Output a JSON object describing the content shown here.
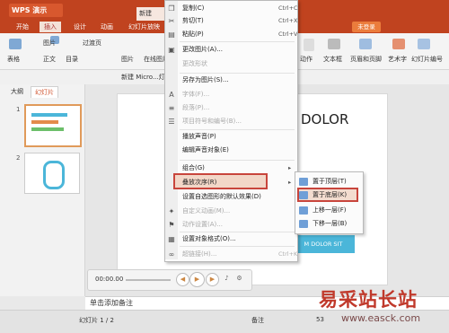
{
  "app": {
    "button_label": "WPS 演示",
    "doc_tab": "新建",
    "login_label": "未登录"
  },
  "menu": [
    "开始",
    "插入",
    "设计",
    "动画",
    "幻灯片放映"
  ],
  "toolbar": {
    "items": [
      "表格",
      "图片",
      "正文",
      "页眉和页脚",
      "目录",
      "动作",
      "文本框",
      "艺术字",
      "幻灯片编号",
      "过渡页",
      "图片",
      "在线图片"
    ],
    "qat_doc": "新建 Micro...灯片"
  },
  "left_panel": {
    "tabs": [
      "大纲",
      "幻灯片"
    ],
    "slides": [
      "1",
      "2"
    ]
  },
  "slide": {
    "title": "DOLOR",
    "banner": "M DOLOR SIT"
  },
  "context_menu": {
    "items": [
      {
        "label": "复制(C)",
        "shortcut": "Ctrl+C",
        "disabled": false,
        "icon": "copy-icon"
      },
      {
        "label": "剪切(T)",
        "shortcut": "Ctrl+X",
        "disabled": false,
        "icon": "cut-icon"
      },
      {
        "label": "粘贴(P)",
        "shortcut": "Ctrl+V",
        "disabled": false,
        "icon": "paste-icon"
      },
      {
        "label": "更改图片(A)...",
        "shortcut": "",
        "disabled": false,
        "icon": "change-picture-icon"
      },
      {
        "label": "更改形状",
        "shortcut": "",
        "disabled": true,
        "icon": ""
      },
      {
        "label": "另存为图片(S)...",
        "shortcut": "",
        "disabled": false,
        "icon": ""
      },
      {
        "label": "字体(F)...",
        "shortcut": "",
        "disabled": true,
        "icon": "font-icon"
      },
      {
        "label": "段落(P)...",
        "shortcut": "",
        "disabled": true,
        "icon": "paragraph-icon"
      },
      {
        "label": "项目符号和编号(B)...",
        "shortcut": "",
        "disabled": true,
        "icon": "bullets-icon"
      },
      {
        "label": "播放声音(P)",
        "shortcut": "",
        "disabled": false,
        "icon": ""
      },
      {
        "label": "编辑声音对象(E)",
        "shortcut": "",
        "disabled": false,
        "icon": ""
      },
      {
        "label": "组合(G)",
        "shortcut": "",
        "disabled": false,
        "icon": ""
      },
      {
        "label": "叠放次序(R)",
        "shortcut": "",
        "disabled": false,
        "icon": ""
      },
      {
        "label": "设置自选图形的默认效果(D)",
        "shortcut": "",
        "disabled": false,
        "icon": ""
      },
      {
        "label": "自定义动画(M)...",
        "shortcut": "",
        "disabled": true,
        "icon": "animation-icon"
      },
      {
        "label": "动作设置(A)...",
        "shortcut": "",
        "disabled": true,
        "icon": "action-icon"
      },
      {
        "label": "设置对象格式(O)...",
        "shortcut": "",
        "disabled": false,
        "icon": "format-icon"
      },
      {
        "label": "超链接(H)...",
        "shortcut": "Ctrl+K",
        "disabled": true,
        "icon": "hyperlink-icon"
      }
    ]
  },
  "submenu": {
    "items": [
      "置于顶层(T)",
      "置于底层(K)",
      "上移一层(F)",
      "下移一层(B)"
    ]
  },
  "player": {
    "time": "00:00.00"
  },
  "notes": {
    "placeholder": "单击添加备注"
  },
  "status": {
    "slide_info": "幻灯片 1 / 2",
    "notes_label": "备注",
    "zoom": "53"
  },
  "watermark": {
    "title": "易采站长站",
    "url": "www.easck.com"
  },
  "colors": {
    "title_bar": "#c0431f",
    "highlight_border": "#c8453c",
    "banner": "#4bb6d9"
  }
}
